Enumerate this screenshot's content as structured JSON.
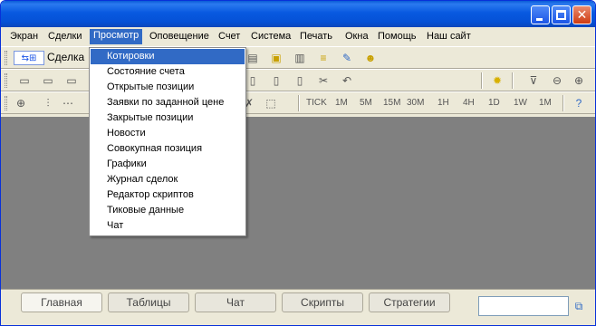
{
  "menubar": {
    "items": [
      "Экран",
      "Сделки",
      "Просмотр",
      "Оповещение",
      "Счет",
      "Система",
      "Печать",
      "Окна",
      "Помощь",
      "Наш сайт"
    ]
  },
  "toolbar": {
    "deal_label": "Сделка",
    "timeframes": [
      "TICK",
      "1M",
      "5M",
      "15M",
      "30M",
      "1H",
      "4H",
      "1D",
      "1W",
      "1M"
    ]
  },
  "view_menu": {
    "items": [
      "Котировки",
      "Состояние счета",
      "Открытые позиции",
      "Заявки по заданной цене",
      "Закрытые позиции",
      "Новости",
      "Совокупная позиция",
      "Графики",
      "Журнал сделок",
      "Редактор скриптов",
      "Тиковые данные",
      "Чат"
    ],
    "highlighted_index": 0
  },
  "tabs": [
    "Главная",
    "Таблицы",
    "Чат",
    "Скрипты",
    "Стратегии"
  ],
  "active_tab": 0,
  "colors": {
    "titlebar": "#0a5bd6",
    "menu_highlight": "#316ac5",
    "workspace": "#808080",
    "chrome": "#ece9d8"
  }
}
